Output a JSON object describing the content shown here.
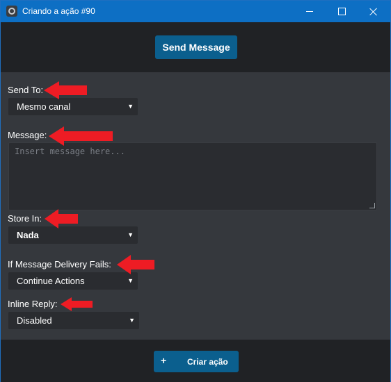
{
  "window": {
    "title": "Criando a ação #90"
  },
  "toolbar": {
    "send_message_label": "Send Message"
  },
  "form": {
    "send_to": {
      "label": "Send To:",
      "value": "Mesmo canal"
    },
    "message": {
      "label": "Message:",
      "placeholder": "Insert message here..."
    },
    "store_in": {
      "label": "Store In:",
      "value": "Nada"
    },
    "delivery_fails": {
      "label": "If Message Delivery Fails:",
      "value": "Continue Actions"
    },
    "inline_reply": {
      "label": "Inline Reply:",
      "value": "Disabled"
    }
  },
  "footer": {
    "create_icon": "+",
    "create_label": "Criar ação"
  },
  "colors": {
    "titlebar": "#0d6fc4",
    "button": "#0b5f8e",
    "annotation_arrow": "#ee1c24"
  }
}
